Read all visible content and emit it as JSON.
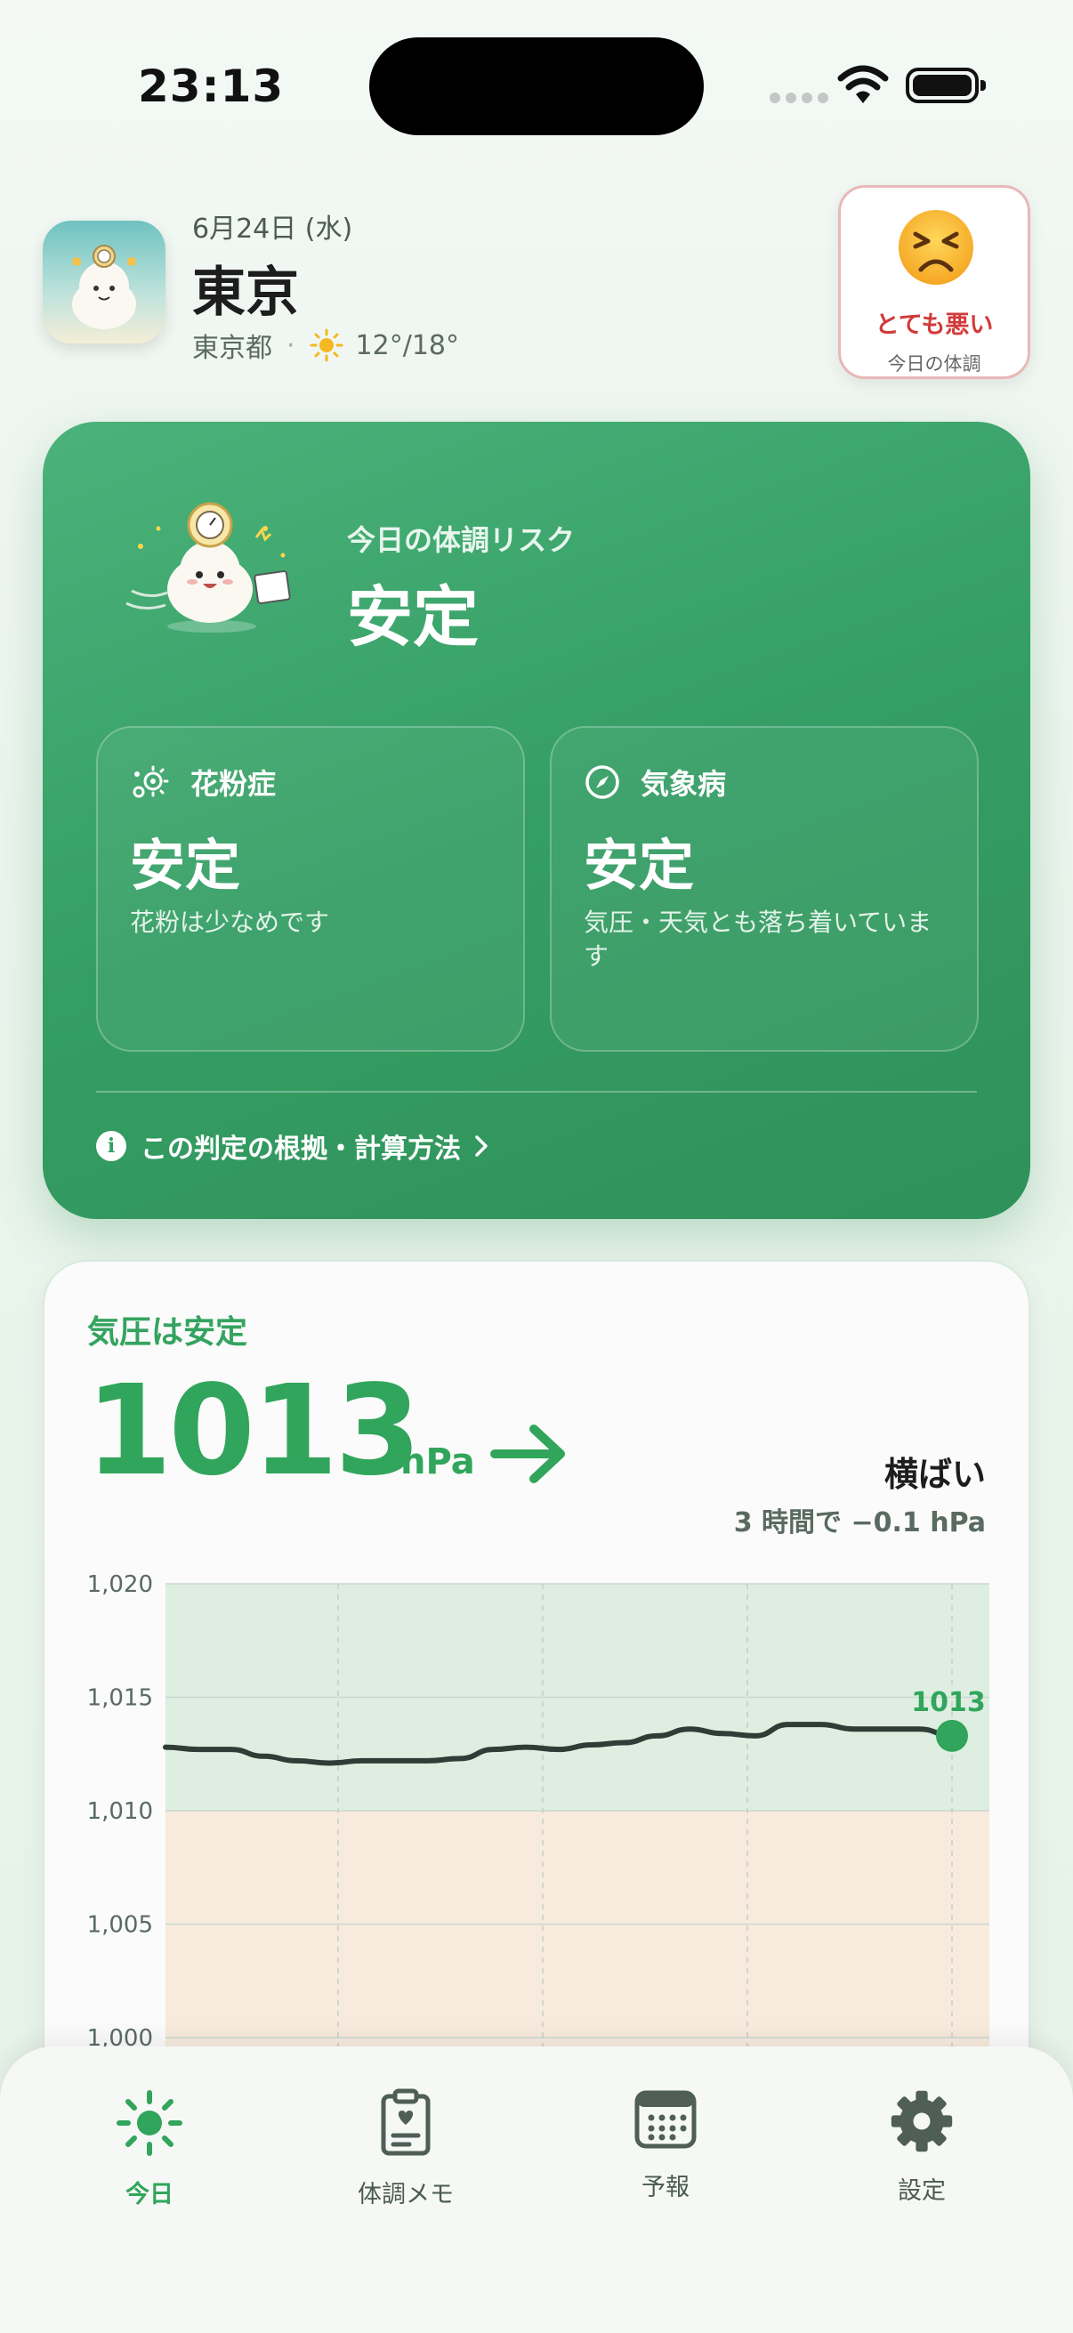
{
  "status": {
    "time": "23:13"
  },
  "header": {
    "date": "6月24日 (水)",
    "city": "東京",
    "prefecture": "東京都",
    "separator": "·",
    "temp": "12°/18°"
  },
  "mood": {
    "label": "とても悪い",
    "caption": "今日の体調",
    "icon": "persevering-face-icon"
  },
  "risk": {
    "caption": "今日の体調リスク",
    "value": "安定",
    "pollen": {
      "title": "花粉症",
      "value": "安定",
      "desc": "花粉は少なめです",
      "icon": "pollen-icon"
    },
    "weather": {
      "title": "気象病",
      "value": "安定",
      "desc": "気圧・天気とも落ち着いています",
      "icon": "compass-icon"
    },
    "link": "この判定の根拠・計算方法",
    "info_glyph": "i"
  },
  "pressure": {
    "title": "気圧は安定",
    "value": "1013",
    "unit": "hPa",
    "trend": "横ばい",
    "trend_sub": "3 時間で −0.1 hPa",
    "colors": {
      "accent": "#31a55b",
      "safe_band": "#deefe2",
      "warn_band": "#f8ebde",
      "line": "#2f3d36"
    }
  },
  "chart_data": {
    "type": "line",
    "ylim": [
      1000,
      1020
    ],
    "yticks": [
      "1,020",
      "1,015",
      "1,010",
      "1,005",
      "1,000"
    ],
    "bands": [
      {
        "from": 1010,
        "to": 1020,
        "color": "#deefe2"
      },
      {
        "from": 1000,
        "to": 1010,
        "color": "#f8ebde"
      }
    ],
    "series": [
      {
        "values": [
          1012.8,
          1012.7,
          1012.7,
          1012.4,
          1012.2,
          1012.1,
          1012.2,
          1012.2,
          1012.2,
          1012.3,
          1012.7,
          1012.8,
          1012.7,
          1012.9,
          1013.0,
          1013.3,
          1013.6,
          1013.4,
          1013.3,
          1013.8,
          1013.8,
          1013.6,
          1013.6,
          1013.6,
          1013.3
        ]
      }
    ],
    "current_label": "1013",
    "current_value": 1013.3
  },
  "tabs": [
    {
      "label": "今日",
      "icon": "sun-icon",
      "active": true
    },
    {
      "label": "体調メモ",
      "icon": "clipboard-heart-icon",
      "active": false
    },
    {
      "label": "予報",
      "icon": "calendar-icon",
      "active": false
    },
    {
      "label": "設定",
      "icon": "gear-icon",
      "active": false
    }
  ]
}
